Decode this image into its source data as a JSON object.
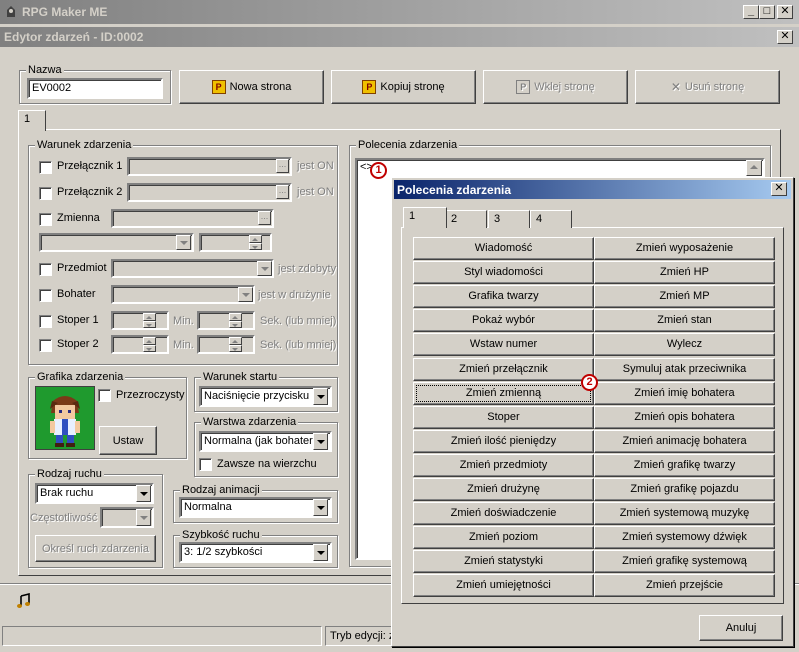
{
  "app": {
    "title": "RPG Maker ME",
    "min_glyph": "_",
    "max_glyph": "□",
    "close_glyph": "✕"
  },
  "editor": {
    "title": "Edytor zdarzeń - ID:0002",
    "close_glyph": "✕",
    "name_label": "Nazwa",
    "name_value": "EV0002",
    "buttons": {
      "new_page": "Nowa strona",
      "copy_page": "Kopiuj stronę",
      "paste_page": "Wklej stronę",
      "delete_page": "Usuń stronę"
    },
    "page_tab": "1",
    "conditions": {
      "label": "Warunek zdarzenia",
      "switch1": "Przełącznik 1",
      "switch2": "Przełącznik 2",
      "is_on": "jest ON",
      "variable": "Zmienna",
      "item": "Przedmiot",
      "item_suffix": "jest zdobyty",
      "hero": "Bohater",
      "hero_suffix": "jest w drużynie",
      "timer1": "Stoper 1",
      "timer2": "Stoper 2",
      "min": "Min.",
      "sec": "Sek. (lub mniej)"
    },
    "graphic": {
      "label": "Grafika zdarzenia",
      "transparent": "Przezroczysty",
      "set_button": "Ustaw"
    },
    "trigger": {
      "label": "Warunek startu",
      "value": "Naciśnięcie przycisku"
    },
    "layer": {
      "label": "Warstwa zdarzenia",
      "value": "Normalna (jak bohater)",
      "always_on_top": "Zawsze na wierzchu"
    },
    "movement": {
      "label": "Rodzaj ruchu",
      "value": "Brak ruchu",
      "frequency_label": "Częstotliwość",
      "define_button": "Określ ruch zdarzenia"
    },
    "animation": {
      "label": "Rodzaj animacji",
      "value": "Normalna"
    },
    "speed": {
      "label": "Szybkość ruchu",
      "value": "3: 1/2 szybkości"
    },
    "commands": {
      "label": "Polecenia zdarzenia",
      "first_line": "<>"
    }
  },
  "status": {
    "edit_mode": "Tryb edycji: ze"
  },
  "markers": [
    "1",
    "2"
  ],
  "dialog": {
    "title": "Polecenia zdarzenia",
    "close_glyph": "✕",
    "tabs": [
      "1",
      "2",
      "3",
      "4"
    ],
    "commands_left": [
      "Wiadomość",
      "Styl wiadomości",
      "Grafika twarzy",
      "Pokaż wybór",
      "Wstaw numer",
      "Zmień przełącznik",
      "Zmień zmienną",
      "Stoper",
      "Zmień ilość pieniędzy",
      "Zmień przedmioty",
      "Zmień drużynę",
      "Zmień doświadczenie",
      "Zmień poziom",
      "Zmień statystyki",
      "Zmień umiejętności"
    ],
    "commands_right": [
      "Zmień wyposażenie",
      "Zmień HP",
      "Zmień MP",
      "Zmień stan",
      "Wylecz",
      "Symuluj atak przeciwnika",
      "Zmień imię bohatera",
      "Zmień opis bohatera",
      "Zmień animację bohatera",
      "Zmień grafikę twarzy",
      "Zmień grafikę pojazdu",
      "Zmień systemową muzykę",
      "Zmień systemowy dźwięk",
      "Zmień grafikę systemową",
      "Zmień przejście"
    ],
    "cancel_button": "Anuluj"
  }
}
